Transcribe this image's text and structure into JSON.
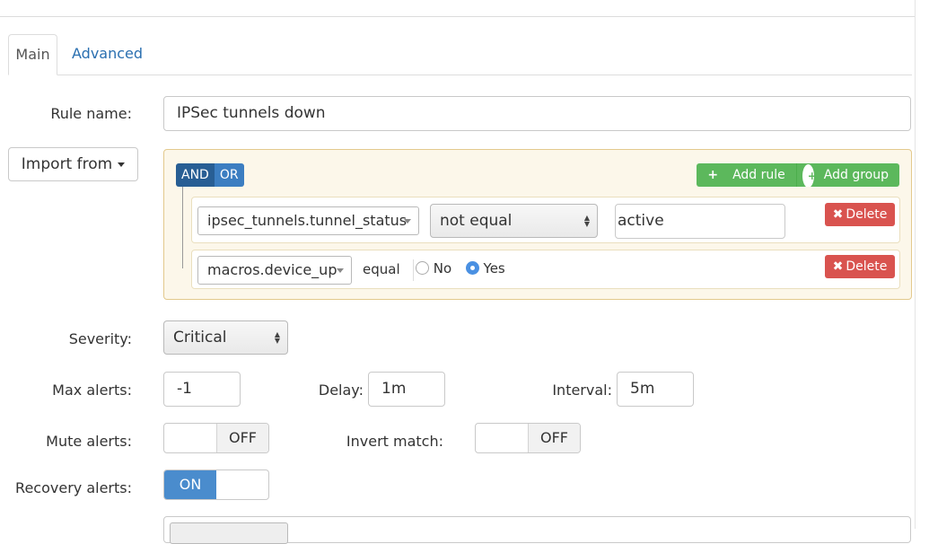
{
  "tabs": [
    {
      "label": "Main",
      "active": true
    },
    {
      "label": "Advanced",
      "active": false
    }
  ],
  "rule_name": {
    "label": "Rule name:",
    "value": "IPSec tunnels down"
  },
  "import_button": {
    "label": "Import from"
  },
  "builder": {
    "and_label": "AND",
    "or_label": "OR",
    "add_rule_label": "Add rule",
    "add_group_label": "Add group",
    "rules": [
      {
        "field": "ipsec_tunnels.tunnel_status",
        "operator": "not equal",
        "value": "active",
        "delete_label": "Delete"
      },
      {
        "field": "macros.device_up",
        "operator": "equal",
        "radio_no": "No",
        "radio_yes": "Yes",
        "selected": "Yes",
        "delete_label": "Delete"
      }
    ]
  },
  "severity": {
    "label": "Severity:",
    "value": "Critical"
  },
  "max_alerts": {
    "label": "Max alerts:",
    "value": "-1"
  },
  "delay": {
    "label": "Delay:",
    "value": "1m"
  },
  "interval": {
    "label": "Interval:",
    "value": "5m"
  },
  "mute_alerts": {
    "label": "Mute alerts:",
    "state": "OFF"
  },
  "invert_match": {
    "label": "Invert match:",
    "state": "OFF"
  },
  "recovery_alerts": {
    "label": "Recovery alerts:",
    "state": "ON"
  },
  "colors": {
    "link": "#2a6fb0",
    "and_active": "#285e94",
    "success": "#5cb85c",
    "danger": "#d9534f",
    "toggle_on": "#4a8ccd"
  }
}
